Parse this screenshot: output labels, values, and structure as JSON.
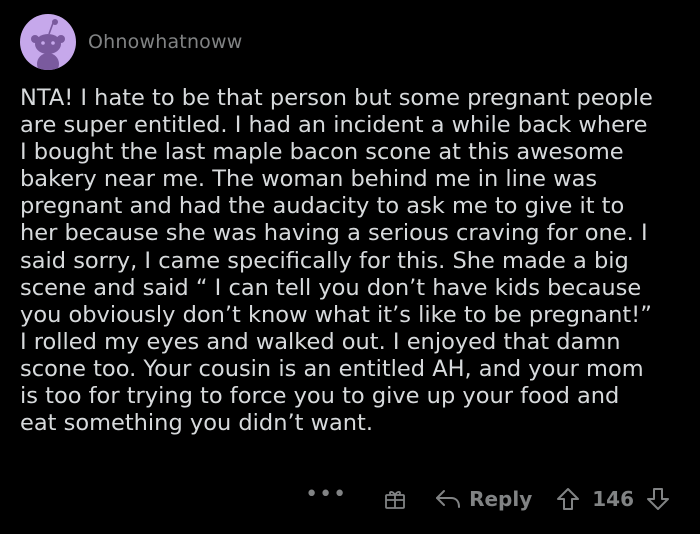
{
  "comment": {
    "username": "Ohnowhatnoww",
    "body": "NTA! I hate to be that person but some pregnant people\nare super entitled. I had an incident a while back where\nI bought the last maple bacon scone at this awesome\nbakery near me. The woman behind me in line was\npregnant and had the audacity to ask me to give it to\nher because she was having a serious craving for one. I\nsaid sorry, I came specifically for this. She made a big\nscene and said “ I can tell you don’t have kids because\nyou obviously don’t know what it’s like to be pregnant!”\nI rolled my eyes and walked out. I enjoyed that damn\nscone too. Your cousin is an entitled AH, and your mom\nis too for trying to force you to give up your food and\neat something you didn’t want.",
    "avatar_icon": "snoo-avatar-icon",
    "avatar_color": "#c6a8eb"
  },
  "actions": {
    "more_label": "•••",
    "award_icon": "award-gift-icon",
    "reply_icon": "reply-arrow-icon",
    "reply_label": "Reply",
    "upvote_icon": "upvote-arrow-icon",
    "score": "146",
    "downvote_icon": "downvote-arrow-icon"
  },
  "theme": {
    "background": "#000000",
    "text": "#d7dadc",
    "muted": "#818384"
  }
}
